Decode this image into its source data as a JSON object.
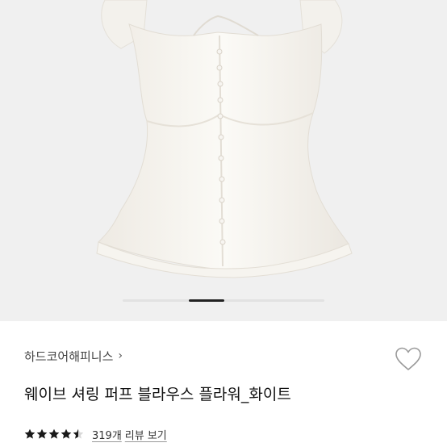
{
  "product": {
    "image_icon": "white-ruffle-sleeveless-blouse-photo",
    "carousel": {
      "active_index": 1,
      "count": 3
    },
    "brand": "하드코어해피니스",
    "brand_chevron": "›",
    "wishlist_icon": "heart-outline-icon",
    "title": "웨이브 셔링 퍼프 블라우스 플라워_화이트",
    "rating": 4.5,
    "review_count": "319개",
    "review_link_label": "리뷰 보기",
    "colors": {
      "star": "#1a1a1a",
      "background": "#f0f0f0"
    }
  }
}
